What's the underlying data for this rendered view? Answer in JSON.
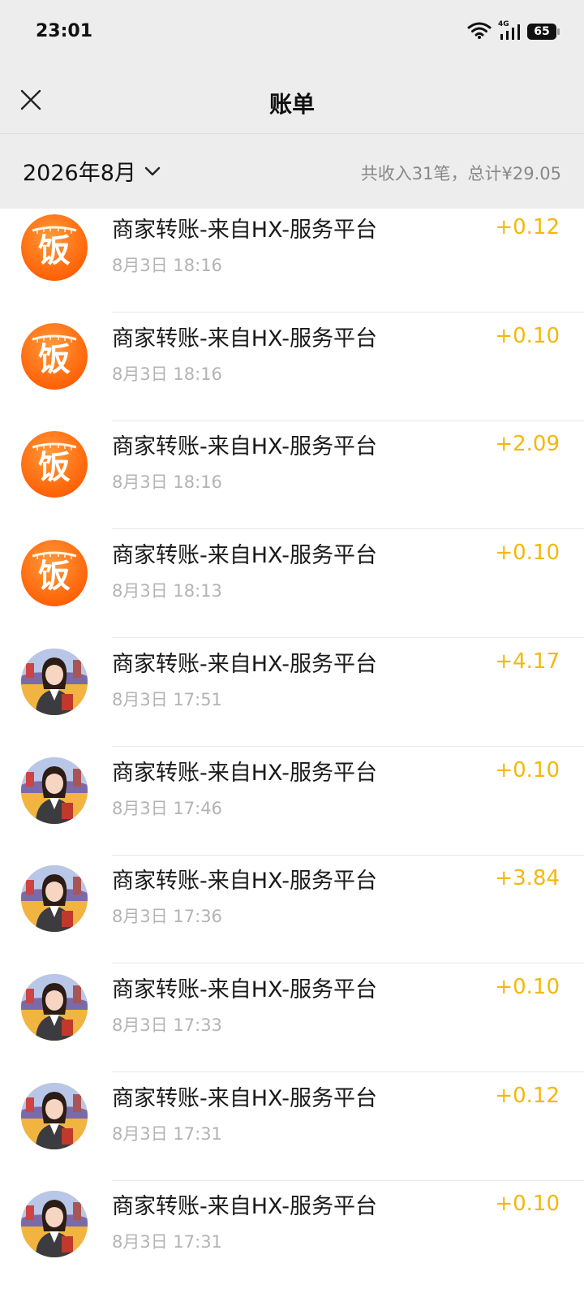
{
  "status": {
    "time": "23:01",
    "network": "4G",
    "battery": "65"
  },
  "header": {
    "title": "账单",
    "close_icon": "close-icon"
  },
  "filter": {
    "month": "2026年8月",
    "summary": "共收入31笔，总计¥29.05"
  },
  "colors": {
    "amount": "#f4b80a",
    "bar_bg": "#ededed",
    "avatar_orange": "#ff7b16"
  },
  "transactions": [
    {
      "avatar": "fan-logo",
      "title": "商家转账-来自HX-服务平台",
      "time": "8月3日 18:16",
      "amount": "+0.12"
    },
    {
      "avatar": "fan-logo",
      "title": "商家转账-来自HX-服务平台",
      "time": "8月3日 18:16",
      "amount": "+0.10"
    },
    {
      "avatar": "fan-logo",
      "title": "商家转账-来自HX-服务平台",
      "time": "8月3日 18:16",
      "amount": "+2.09"
    },
    {
      "avatar": "fan-logo",
      "title": "商家转账-来自HX-服务平台",
      "time": "8月3日 18:13",
      "amount": "+0.10"
    },
    {
      "avatar": "woman-avatar",
      "title": "商家转账-来自HX-服务平台",
      "time": "8月3日 17:51",
      "amount": "+4.17"
    },
    {
      "avatar": "woman-avatar",
      "title": "商家转账-来自HX-服务平台",
      "time": "8月3日 17:46",
      "amount": "+0.10"
    },
    {
      "avatar": "woman-avatar",
      "title": "商家转账-来自HX-服务平台",
      "time": "8月3日 17:36",
      "amount": "+3.84"
    },
    {
      "avatar": "woman-avatar",
      "title": "商家转账-来自HX-服务平台",
      "time": "8月3日 17:33",
      "amount": "+0.10"
    },
    {
      "avatar": "woman-avatar",
      "title": "商家转账-来自HX-服务平台",
      "time": "8月3日 17:31",
      "amount": "+0.12"
    },
    {
      "avatar": "woman-avatar",
      "title": "商家转账-来自HX-服务平台",
      "time": "8月3日 17:31",
      "amount": "+0.10"
    }
  ]
}
